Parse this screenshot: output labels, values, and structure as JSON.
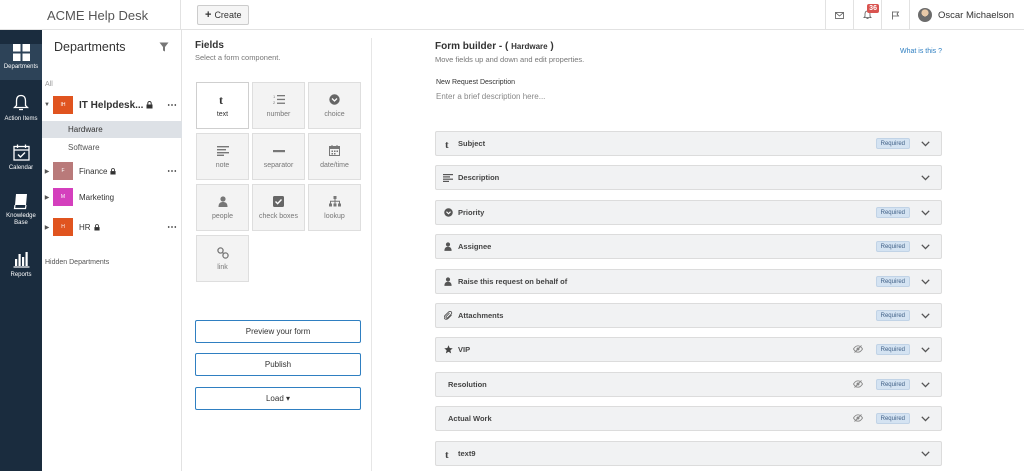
{
  "app": {
    "brand": "ACME Help Desk",
    "create_label": "Create"
  },
  "topbar": {
    "notif_count": "36",
    "user_name": "Oscar Michaelson"
  },
  "nav": [
    {
      "label": "Departments",
      "icon": "grid-icon"
    },
    {
      "label": "Action Items",
      "icon": "bell-icon"
    },
    {
      "label": "Calendar",
      "icon": "calendar-check-icon"
    },
    {
      "label": "Knowledge Base",
      "icon": "book-icon"
    },
    {
      "label": "Reports",
      "icon": "bar-chart-icon"
    }
  ],
  "departments": {
    "title": "Departments",
    "all_label": "All",
    "items": [
      {
        "abbr": "IH",
        "name": "IT Helpdesk...",
        "color": "#e0541f"
      },
      {
        "abbr": "F",
        "name": "Finance",
        "color": "#b97a7a"
      },
      {
        "abbr": "M",
        "name": "Marketing",
        "color": "#d43fbd"
      },
      {
        "abbr": "H",
        "name": "HR",
        "color": "#e0541f"
      }
    ],
    "sub_items": [
      "Hardware",
      "Software"
    ],
    "hidden_label": "Hidden Departments"
  },
  "fields_panel": {
    "title": "Fields",
    "subtitle": "Select a form component.",
    "tiles": [
      {
        "label": "text",
        "icon": "text-icon"
      },
      {
        "label": "number",
        "icon": "number-list-icon"
      },
      {
        "label": "choice",
        "icon": "choice-icon"
      },
      {
        "label": "note",
        "icon": "note-icon"
      },
      {
        "label": "separator",
        "icon": "separator-icon"
      },
      {
        "label": "date/time",
        "icon": "calendar-icon"
      },
      {
        "label": "people",
        "icon": "person-icon"
      },
      {
        "label": "check boxes",
        "icon": "checkbox-icon"
      },
      {
        "label": "lookup",
        "icon": "lookup-icon"
      },
      {
        "label": "link",
        "icon": "link-icon"
      }
    ],
    "preview_label": "Preview your form",
    "publish_label": "Publish",
    "load_label": "Load ▾"
  },
  "form_builder": {
    "title": "Form builder - (",
    "dept": "Hardware",
    "close_paren": ")",
    "subtitle": "Move fields up and down and edit properties.",
    "what_is": "What is this ?",
    "desc_label": "New Request Description",
    "desc_placeholder": "Enter a brief description here...",
    "required_label": "Required",
    "rows": [
      {
        "label": "Subject",
        "icon": "text-icon",
        "required": true,
        "hidden": false
      },
      {
        "label": "Description",
        "icon": "note-icon",
        "required": false,
        "hidden": false
      },
      {
        "label": "Priority",
        "icon": "choice-icon",
        "required": true,
        "hidden": false
      },
      {
        "label": "Assignee",
        "icon": "person-icon",
        "required": true,
        "hidden": false
      },
      {
        "label": "Raise this request on behalf of",
        "icon": "person-icon",
        "required": true,
        "hidden": false
      },
      {
        "label": "Attachments",
        "icon": "paperclip-icon",
        "required": true,
        "hidden": false
      },
      {
        "label": "VIP",
        "icon": "star-icon",
        "required": true,
        "hidden": true
      },
      {
        "label": "Resolution",
        "icon": "",
        "required": true,
        "hidden": true
      },
      {
        "label": "Actual Work",
        "icon": "",
        "required": true,
        "hidden": true
      },
      {
        "label": "text9",
        "icon": "text-icon",
        "required": false,
        "hidden": false
      }
    ]
  },
  "colors": {
    "nav_bg": "#1a2c3e",
    "accent": "#2f7fc1",
    "badge": "#d9534f"
  }
}
